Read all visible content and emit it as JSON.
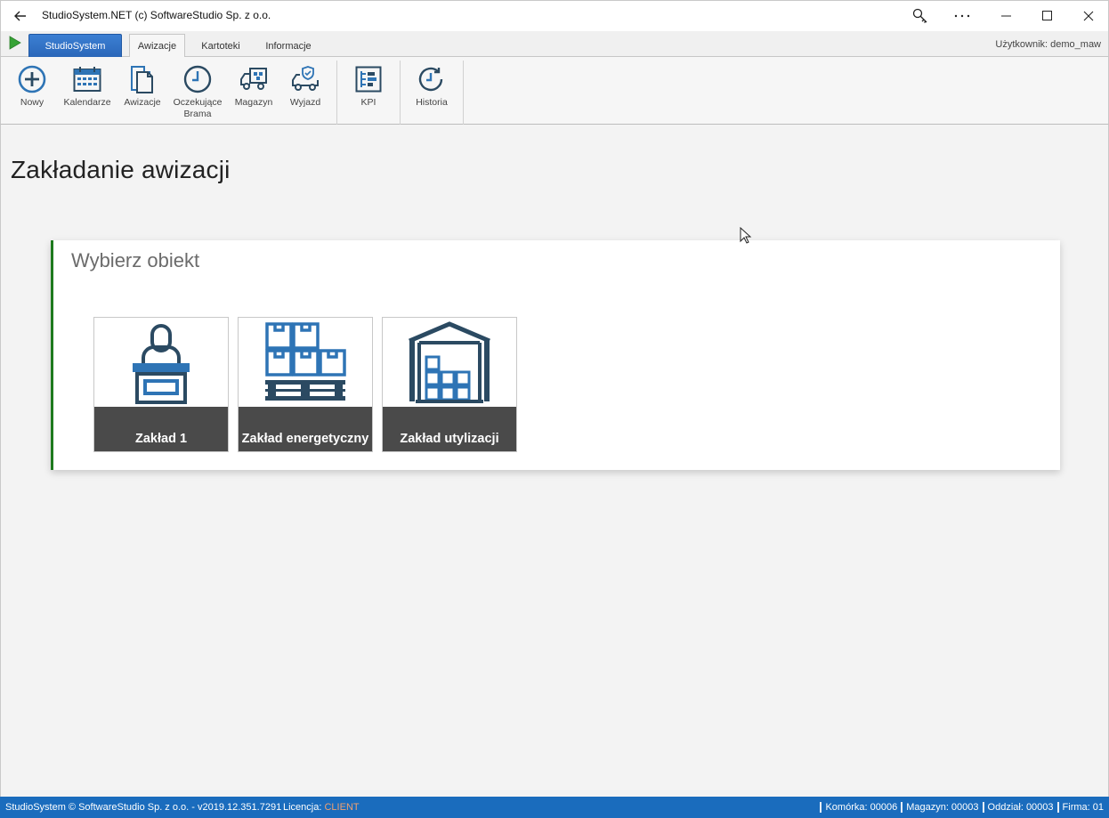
{
  "window": {
    "title": "StudioSystem.NET (c) SoftwareStudio Sp. z o.o.",
    "back_icon": "back-arrow-icon",
    "controls": [
      "key-icon",
      "more-icon",
      "minimize-icon",
      "maximize-icon",
      "close-icon"
    ]
  },
  "tabs": {
    "app_tab": "StudioSystem",
    "items": [
      {
        "label": "Awizacje",
        "active": true
      },
      {
        "label": "Kartoteki",
        "active": false
      },
      {
        "label": "Informacje",
        "active": false
      }
    ],
    "user": "Użytkownik: demo_maw"
  },
  "ribbon": {
    "buttons": [
      {
        "label": "Nowy",
        "icon": "plus-circle-icon"
      },
      {
        "label": "Kalendarze",
        "icon": "calendar-icon"
      },
      {
        "label": "Awizacje",
        "icon": "documents-icon"
      },
      {
        "label": "Oczekujące Brama",
        "icon": "clock-icon"
      },
      {
        "label": "Magazyn",
        "icon": "truck-icon"
      },
      {
        "label": "Wyjazd",
        "icon": "truck-shield-icon"
      },
      {
        "label": "KPI",
        "icon": "kpi-icon"
      },
      {
        "label": "Historia",
        "icon": "history-icon"
      }
    ]
  },
  "main": {
    "page_title": "Zakładanie awizacji",
    "card_title": "Wybierz obiekt",
    "tiles": [
      {
        "label": "Zakład 1",
        "icon": "reception-desk-icon"
      },
      {
        "label": "Zakład energetyczny",
        "icon": "pallet-boxes-icon"
      },
      {
        "label": "Zakład utylizacji",
        "icon": "warehouse-icon"
      }
    ]
  },
  "status": {
    "left": "StudioSystem © SoftwareStudio Sp. z o.o. - v2019.12.351.7291",
    "license_label": "Licencja:",
    "license_value": "CLIENT",
    "komorka": "Komórka: 00006",
    "magazyn": "Magazyn: 00003",
    "oddzial": "Oddział: 00003",
    "firma": "Firma: 01"
  },
  "colors": {
    "accent_blue": "#2a67b9",
    "icon_blue": "#2e74b5",
    "icon_dark": "#2b4a62",
    "card_border_green": "#1e7a1e",
    "status_bar": "#1a6cbd",
    "license_value": "#f0a070"
  }
}
